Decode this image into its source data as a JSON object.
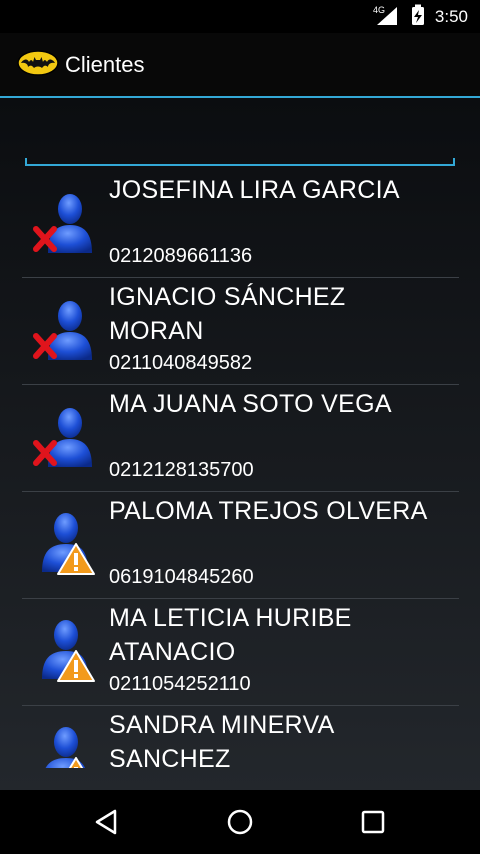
{
  "status": {
    "time": "3:50",
    "network": "4G"
  },
  "app": {
    "title": "Clientes",
    "logo": "batman-logo"
  },
  "search": {
    "value": "",
    "placeholder": ""
  },
  "clients": [
    {
      "name": "JOSEFINA LIRA GARCIA",
      "phone": "0212089661136",
      "status_icon": "red-x"
    },
    {
      "name": "IGNACIO SÁNCHEZ MORAN",
      "phone": "0211040849582",
      "status_icon": "red-x"
    },
    {
      "name": "MA JUANA SOTO VEGA",
      "phone": "0212128135700",
      "status_icon": "red-x"
    },
    {
      "name": "PALOMA TREJOS OLVERA",
      "phone": "0619104845260",
      "status_icon": "warning"
    },
    {
      "name": "MA LETICIA HURIBE ATANACIO",
      "phone": "0211054252110",
      "status_icon": "warning"
    },
    {
      "name": "SANDRA MINERVA SANCHEZ",
      "phone": "",
      "status_icon": "warning"
    }
  ],
  "colors": {
    "accent": "#33a8d6",
    "person": "#1d4fd6",
    "error": "#e0141c",
    "warning": "#f29a1c"
  }
}
